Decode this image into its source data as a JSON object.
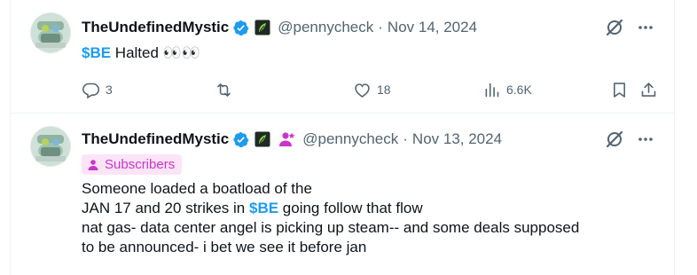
{
  "tweets": [
    {
      "author_name": "TheUndefinedMystic",
      "handle": "@pennycheck",
      "separator": "·",
      "date": "Nov 14, 2024",
      "cashtag": "$BE",
      "text_rest": " Halted 👀👀",
      "subscriber_badge": false,
      "actions": {
        "replies": "3",
        "reposts": "",
        "likes": "18",
        "views": "6.6K"
      }
    },
    {
      "author_name": "TheUndefinedMystic",
      "handle": "@pennycheck",
      "separator": "·",
      "date": "Nov 13, 2024",
      "subscriber_badge": true,
      "badge_label": "Subscribers",
      "text_before_cashtag": "Someone loaded a boatload of the\nJAN 17 and 20 strikes in ",
      "cashtag": "$BE",
      "text_after_cashtag": " going follow that flow\nnat gas- data center angel is picking up steam-- and some deals supposed\nto be announced- i bet we see it before jan"
    }
  ],
  "icons": {
    "verified": "verified-badge-icon",
    "affiliate": "affiliate-leaf-icon",
    "subscriber": "subscriber-person-icon",
    "grok": "grok-icon",
    "more": "more-dots-icon",
    "reply": "reply-icon",
    "repost": "repost-icon",
    "like": "heart-icon",
    "views": "views-bars-icon",
    "bookmark": "bookmark-icon",
    "share": "share-icon"
  },
  "colors": {
    "accent": "#1d9bf0",
    "secondary_text": "#536471",
    "badge_bg": "#fce4f7",
    "badge_text": "#c935c9",
    "divider": "#eff3f4"
  }
}
